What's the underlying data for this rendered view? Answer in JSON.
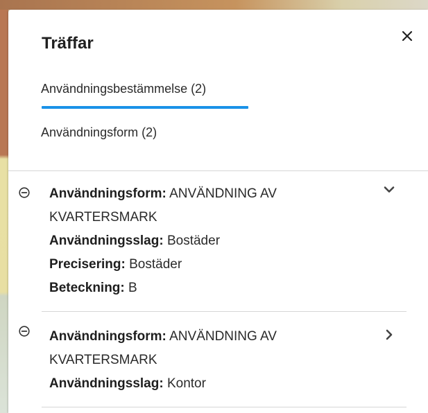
{
  "panel": {
    "title": "Träffar",
    "close_icon": "close-icon"
  },
  "tabs": [
    {
      "label": "Användningsbestämmelse (2)",
      "active": true
    },
    {
      "label": "Användningsform (2)",
      "active": false
    }
  ],
  "results": [
    {
      "status_icon": "minus-circle-icon",
      "chevron_icon": "chevron-down-icon",
      "fields": [
        {
          "label": "Användningsform:",
          "value": "ANVÄNDNING AV KVARTERSMARK"
        },
        {
          "label": "Användningsslag:",
          "value": "Bostäder"
        },
        {
          "label": "Precisering:",
          "value": "Bostäder"
        },
        {
          "label": "Beteckning:",
          "value": "B"
        }
      ]
    },
    {
      "status_icon": "minus-circle-icon",
      "chevron_icon": "chevron-right-icon",
      "fields": [
        {
          "label": "Användningsform:",
          "value": "ANVÄNDNING AV KVARTERSMARK"
        },
        {
          "label": "Användningsslag:",
          "value": "Kontor"
        }
      ]
    }
  ],
  "colors": {
    "accent": "#1a92e8",
    "panel_background": "#ffffff",
    "divider": "#d6d6d6"
  }
}
